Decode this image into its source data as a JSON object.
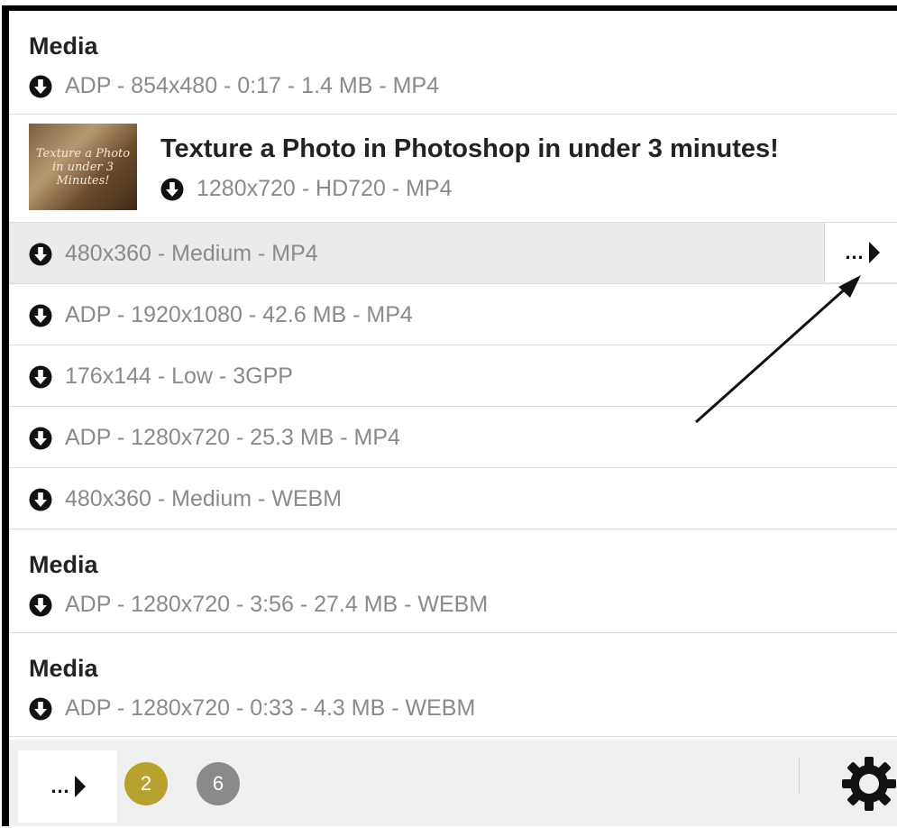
{
  "groups": [
    {
      "title": "Media",
      "meta": "ADP - 854x480 - 0:17 - 1.4 MB - MP4"
    }
  ],
  "video": {
    "title": "Texture a Photo in Photoshop in under 3 minutes!",
    "meta": "1280x720 - HD720 - MP4",
    "thumbnail_text": "Texture a Photo in under 3 Minutes!"
  },
  "formats": [
    "480x360 - Medium - MP4",
    "ADP - 1920x1080 - 42.6 MB - MP4",
    "176x144 - Low - 3GPP",
    "ADP - 1280x720 - 25.3 MB - MP4",
    "480x360 - Medium - WEBM"
  ],
  "media_items": [
    {
      "title": "Media",
      "meta": "ADP - 1280x720 - 3:56 - 27.4 MB - WEBM"
    },
    {
      "title": "Media",
      "meta": "ADP - 1280x720 - 0:33 - 4.3 MB - WEBM"
    }
  ],
  "more_label": "…",
  "footer": {
    "more_label": "…",
    "badges": [
      {
        "value": "2",
        "color": "#b8a12e"
      },
      {
        "value": "6",
        "color": "#8a8a8a"
      }
    ]
  },
  "icons": {
    "download": "download-circle-icon",
    "more": "more-arrow-icon",
    "settings": "gear-icon"
  },
  "colors": {
    "highlight_row": "#ebebeb",
    "footer_bg": "#f0f0f0",
    "meta_text": "#8a8a8a"
  }
}
